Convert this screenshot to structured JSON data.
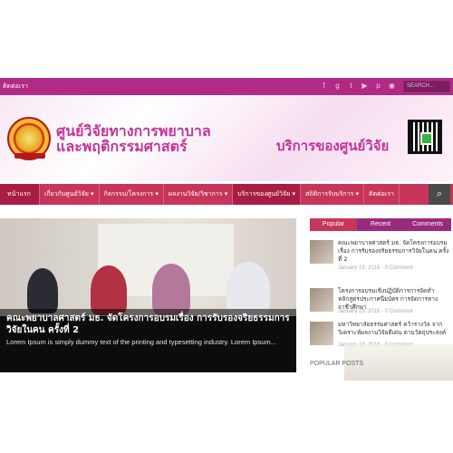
{
  "topbar": {
    "contact_label": "ติดต่อเรา",
    "social_icons": [
      "facebook-icon",
      "google-plus-icon",
      "twitter-icon",
      "youtube-icon",
      "pinterest-icon",
      "rss-icon"
    ],
    "search_placeholder": "SEARCH..."
  },
  "header": {
    "title_line1": "ศูนย์วิจัยทางการพยาบาล",
    "title_line2": "และพฤติกรรมศาสตร์",
    "service_title": "บริการของศูนย์วิจัย"
  },
  "nav": {
    "items": [
      {
        "label": "หน้าแรก"
      },
      {
        "label": "เกี่ยวกับศูนย์วิจัย ▾"
      },
      {
        "label": "กิจกรรม/โครงการ ▾"
      },
      {
        "label": "ผลงานวิจัย/วิชาการ ▾"
      },
      {
        "label": "บริการของศูนย์วิจัย ▾"
      },
      {
        "label": "สถิติการรับบริการ ▾"
      },
      {
        "label": "ติดต่อเรา"
      }
    ]
  },
  "hero": {
    "title": "คณะพยาบาลศาสตร์ มธ. จัดโครงการอบรมเรื่อง การรับรองจริยธรรมการวิจัยในคน ครั้งที่ 2",
    "excerpt": "Lorem Ipsum is simply dummy text of the printing and typesetting industry. Lorem Ipsum..."
  },
  "sidebar": {
    "tabs": [
      "Popular",
      "Recent",
      "Comments"
    ],
    "posts": [
      {
        "title": "คณะพยาบาลศาสตร์ มธ. จัดโครงการอบรมเรื่อง การรับรองจริยธรรมการวิจัยในคน ครั้งที่ 2",
        "meta": "January 19, 2016 - 0 Comment"
      },
      {
        "title": "โครงการอบรมเชิงปฏิบัติการการจัดทำหลักสูตรประกาศนียบัตร การจัดการทางอาชีวศึกษา",
        "meta": "January 19, 2016 - 0 Comment"
      },
      {
        "title": "มหาวิทยาลัยธรรมศาสตร์ คว้ารางวัล จากวิเคราะห์ผลงานวิจัยดีเด่น ตามวัตถุประสงค์",
        "meta": "January 19, 2016 - 0 Comment"
      }
    ],
    "popular_posts_label": "POPULAR POSTS"
  }
}
